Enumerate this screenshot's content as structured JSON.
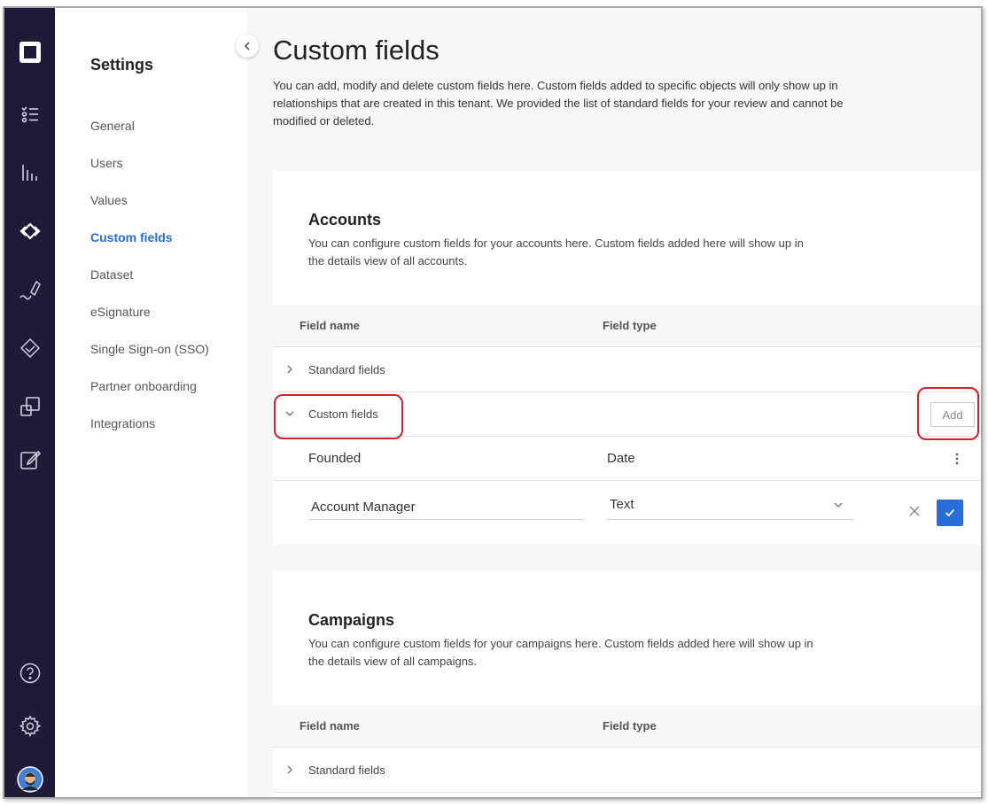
{
  "settings": {
    "title": "Settings",
    "menu": [
      "General",
      "Users",
      "Values",
      "Custom fields",
      "Dataset",
      "eSignature",
      "Single Sign-on (SSO)",
      "Partner onboarding",
      "Integrations"
    ],
    "active_item": "Custom fields"
  },
  "rail": {
    "icons": [
      "logo-icon",
      "tasks-icon",
      "analytics-icon",
      "partnerships-icon",
      "signature-icon",
      "handshake-icon",
      "screens-icon",
      "edit-note-icon",
      "help-icon",
      "gear-icon",
      "avatar"
    ]
  },
  "page": {
    "title": "Custom fields",
    "description": "You can add, modify and delete custom fields here. Custom fields added to specific objects will only show up in relationships that are created in this tenant. We provided the list of standard fields for your review and cannot be modified or deleted."
  },
  "accounts": {
    "title": "Accounts",
    "description": "You can configure custom fields for your accounts here. Custom fields added here will show up in the details view of all accounts.",
    "col_name": "Field name",
    "col_type": "Field type",
    "standard_label": "Standard fields",
    "custom_label": "Custom fields",
    "add_label": "Add",
    "rows": [
      {
        "name": "Founded",
        "type": "Date"
      }
    ],
    "edit_row": {
      "name_value": "Account Manager",
      "type_value": "Text"
    }
  },
  "campaigns": {
    "title": "Campaigns",
    "description": "You can configure custom fields for your campaigns here. Custom fields added here will show up in the details view of all campaigns.",
    "col_name": "Field name",
    "col_type": "Field type",
    "standard_label": "Standard fields"
  },
  "colors": {
    "rail": "#1e1a38",
    "accent": "#2b6dd6",
    "highlight": "#d61f26"
  }
}
